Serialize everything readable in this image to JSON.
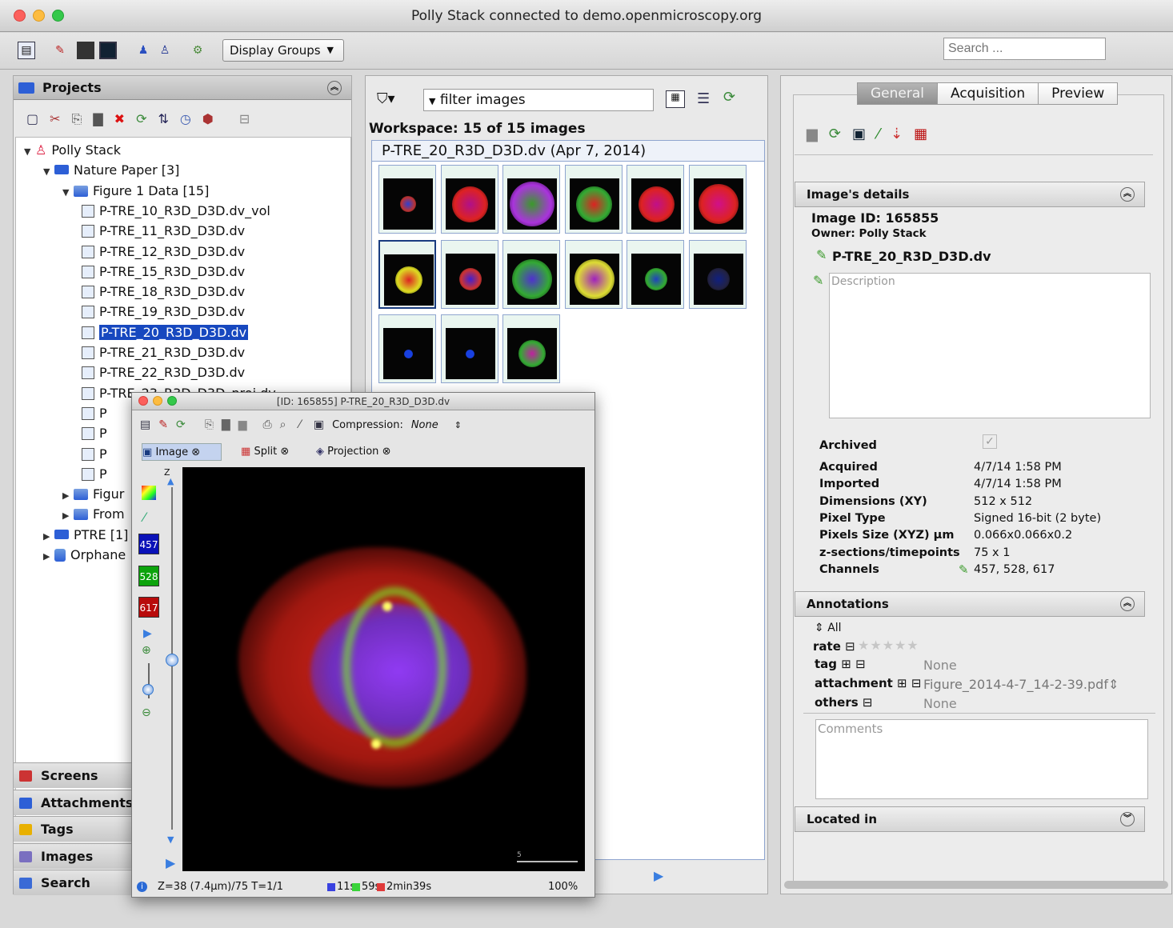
{
  "window": {
    "title": "Polly Stack connected to demo.openmicroscopy.org"
  },
  "toolbar": {
    "display_groups": "Display Groups",
    "search_placeholder": "Search ..."
  },
  "left": {
    "header": "Projects",
    "tree": [
      {
        "label": "Polly Stack",
        "level": 0,
        "icon": "user-icon",
        "expanded": true
      },
      {
        "label": "Nature Paper [3]",
        "level": 1,
        "icon": "project-folder-icon",
        "expanded": true
      },
      {
        "label": "Figure 1 Data [15]",
        "level": 2,
        "icon": "dataset-icon",
        "expanded": true
      },
      {
        "label": "P-TRE_10_R3D_D3D.dv_vol",
        "level": 3,
        "icon": "image-icon"
      },
      {
        "label": "P-TRE_11_R3D_D3D.dv",
        "level": 3,
        "icon": "image-icon"
      },
      {
        "label": "P-TRE_12_R3D_D3D.dv",
        "level": 3,
        "icon": "image-icon"
      },
      {
        "label": "P-TRE_15_R3D_D3D.dv",
        "level": 3,
        "icon": "image-icon"
      },
      {
        "label": "P-TRE_18_R3D_D3D.dv",
        "level": 3,
        "icon": "image-icon"
      },
      {
        "label": "P-TRE_19_R3D_D3D.dv",
        "level": 3,
        "icon": "image-icon"
      },
      {
        "label": "P-TRE_20_R3D_D3D.dv",
        "level": 3,
        "icon": "image-icon",
        "selected": true
      },
      {
        "label": "P-TRE_21_R3D_D3D.dv",
        "level": 3,
        "icon": "image-icon"
      },
      {
        "label": "P-TRE_22_R3D_D3D.dv",
        "level": 3,
        "icon": "image-icon"
      },
      {
        "label": "P-TRE_23_R3D_D3D_proj.dv",
        "level": 3,
        "icon": "image-icon"
      },
      {
        "label": "P",
        "level": 3,
        "icon": "image-icon"
      },
      {
        "label": "P",
        "level": 3,
        "icon": "image-icon"
      },
      {
        "label": "P",
        "level": 3,
        "icon": "image-icon"
      },
      {
        "label": "P",
        "level": 3,
        "icon": "image-icon"
      },
      {
        "label": "Figur",
        "level": 2,
        "icon": "dataset-icon"
      },
      {
        "label": "From",
        "level": 2,
        "icon": "dataset-icon"
      },
      {
        "label": "PTRE [1]",
        "level": 1,
        "icon": "project-folder-icon"
      },
      {
        "label": "Orphane",
        "level": 1,
        "icon": "orphan-icon"
      }
    ],
    "bottom_tabs": [
      "Screens",
      "Attachments",
      "Tags",
      "Images",
      "Search"
    ]
  },
  "middle": {
    "filter": "filter  images",
    "workspace": "Workspace: 15 of 15 images",
    "group_header": "P-TRE_20_R3D_D3D.dv (Apr 7, 2014)"
  },
  "right": {
    "tabs": [
      "General",
      "Acquisition",
      "Preview"
    ],
    "details_header": "Image's details",
    "image_id": "Image ID: 165855",
    "owner": "Owner: Polly Stack",
    "name": "P-TRE_20_R3D_D3D.dv",
    "description_placeholder": "Description",
    "archived_label": "Archived",
    "fields": [
      {
        "label": "Acquired",
        "value": "4/7/14 1:58 PM"
      },
      {
        "label": "Imported",
        "value": "4/7/14 1:58 PM"
      },
      {
        "label": "Dimensions (XY)",
        "value": "512 x 512"
      },
      {
        "label": "Pixel Type",
        "value": "Signed 16-bit (2 byte)"
      },
      {
        "label": "Pixels Size (XYZ) µm",
        "value": "0.066x0.066x0.2"
      },
      {
        "label": "z-sections/timepoints",
        "value": "75 x 1"
      },
      {
        "label": "Channels",
        "value": "457, 528, 617"
      }
    ],
    "annotations_header": "Annotations",
    "ann_all": "All",
    "ann_rate": "rate",
    "ann_tag": "tag",
    "ann_tag_val": "None",
    "ann_attachment": "attachment",
    "ann_attachment_val": "Figure_2014-4-7_14-2-39.pdf",
    "ann_others": "others",
    "ann_others_val": "None",
    "comments_placeholder": "Comments",
    "located_header": "Located in"
  },
  "viewer": {
    "title": "[ID: 165855] P-TRE_20_R3D_D3D.dv",
    "compression_label": "Compression:",
    "compression_value": "None",
    "tabs": [
      "Image",
      "Split",
      "Projection"
    ],
    "channels": [
      "457",
      "528",
      "617"
    ],
    "z_label": "Z",
    "scalebar": "5",
    "status_z": "Z=38 (7.4µm)/75 T=1/1",
    "status_times": [
      "11s",
      "59s",
      "2min39s"
    ],
    "zoom": "100%"
  },
  "colors": {
    "selection": "#1748bf",
    "ch457": "#0a12b8",
    "ch528": "#0ca30c",
    "ch617": "#b80b0b"
  }
}
